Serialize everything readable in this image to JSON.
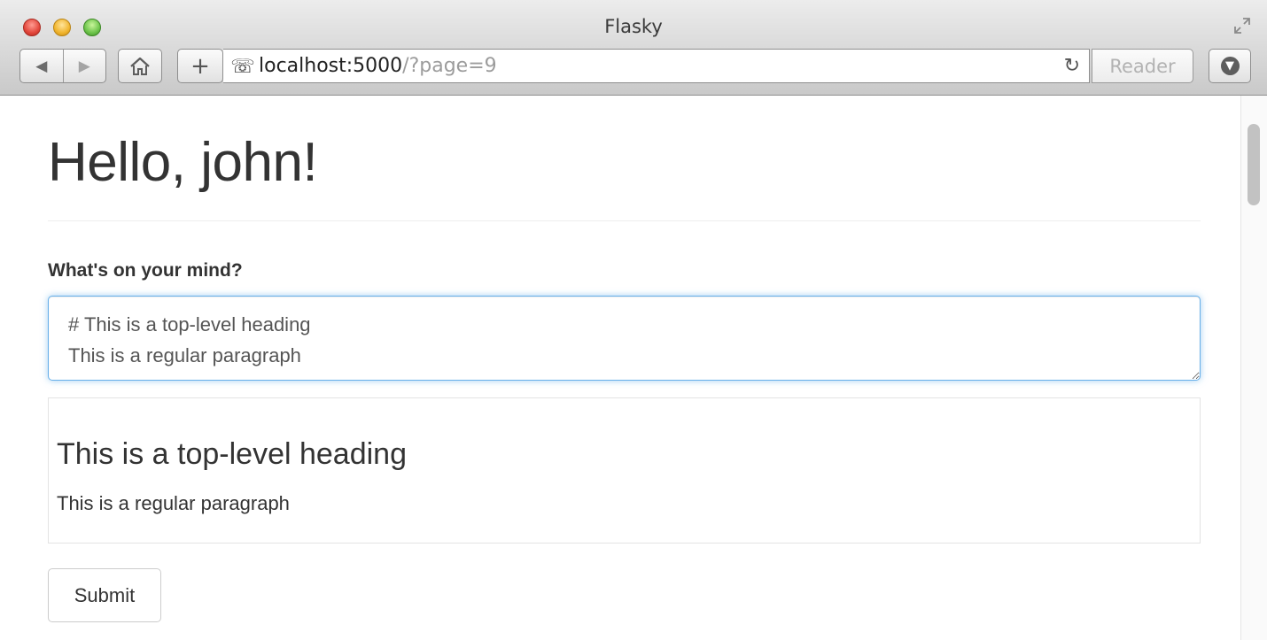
{
  "window": {
    "title": "Flasky"
  },
  "toolbar": {
    "back_icon": "back-arrow",
    "forward_icon": "forward-arrow",
    "home_icon": "home",
    "new_tab_label": "+",
    "url_host": "localhost:5000",
    "url_path": "/?page=9",
    "reload_icon": "reload",
    "reader_label": "Reader",
    "download_icon": "download"
  },
  "page": {
    "greeting": "Hello, john!",
    "form": {
      "label": "What's on your mind?",
      "body_value": "# This is a top-level heading\nThis is a regular paragraph",
      "submit_label": "Submit"
    },
    "preview": {
      "heading": "This is a top-level heading",
      "paragraph": "This is a regular paragraph"
    }
  },
  "colors": {
    "focus_border": "#66afe9",
    "text": "#333333",
    "url_path": "#9c9c9c"
  }
}
